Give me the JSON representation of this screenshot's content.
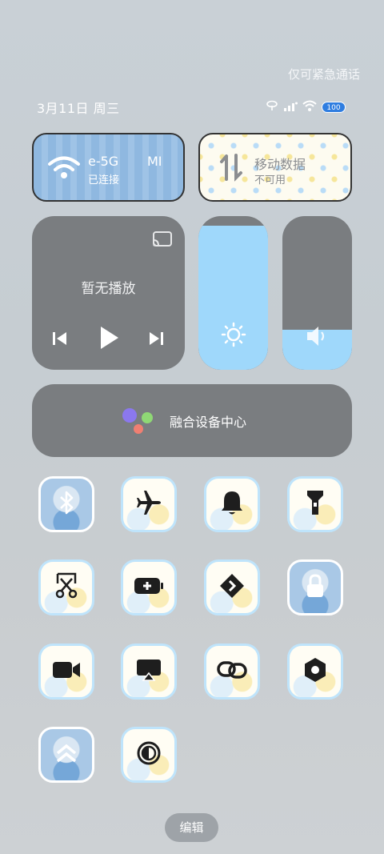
{
  "status_bar": {
    "emergency_text": "仅可紧急通话",
    "date": "3月11日 周三",
    "battery": "100"
  },
  "tiles": {
    "wifi": {
      "name": "e-5G",
      "name_extra": "MI",
      "status": "已连接"
    },
    "mobile_data": {
      "label": "移动数据",
      "status": "不可用"
    }
  },
  "media": {
    "title": "暂无播放"
  },
  "sliders": {
    "brightness_level": 0.94,
    "volume_level": 0.26
  },
  "device_center": {
    "label": "融合设备中心"
  },
  "toggles": [
    {
      "name": "bluetooth",
      "on": true
    },
    {
      "name": "airplane",
      "on": false
    },
    {
      "name": "bell",
      "on": false
    },
    {
      "name": "flashlight",
      "on": false
    },
    {
      "name": "screenshot",
      "on": false
    },
    {
      "name": "battery-saver",
      "on": false
    },
    {
      "name": "nfc",
      "on": false
    },
    {
      "name": "lock",
      "on": true
    },
    {
      "name": "screen-record",
      "on": false
    },
    {
      "name": "screen-cast",
      "on": false
    },
    {
      "name": "link",
      "on": false
    },
    {
      "name": "settings",
      "on": false
    },
    {
      "name": "collapse",
      "on": true
    },
    {
      "name": "dark-mode",
      "on": false
    }
  ],
  "edit_button": {
    "label": "编辑"
  },
  "colors": {
    "accent": "#9fd8fb",
    "panel": "#7a7d80"
  }
}
